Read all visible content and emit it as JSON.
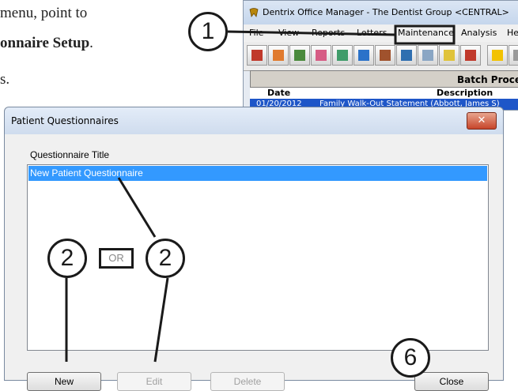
{
  "instructions": {
    "line1": "menu, point to",
    "line2": "onnaire Setup",
    "line2_period": ".",
    "line3": "s."
  },
  "office_manager": {
    "title": "Dentrix Office Manager - The Dentist Group <CENTRAL>",
    "menu": [
      "File",
      "View",
      "Reports",
      "Letters",
      "Maintenance",
      "Analysis",
      "He"
    ],
    "toolbar_icons": [
      "chart-icon",
      "patient-icon",
      "document-icon",
      "tooth-icon",
      "pencil-icon",
      "pen-icon",
      "book-icon",
      "man-icon",
      "window-icon",
      "note-icon",
      "chart2-icon",
      "lightning-icon",
      "info-icon"
    ],
    "batch_header": "Batch Proce",
    "columns": [
      "Date",
      "Description"
    ],
    "row": {
      "date": "01/20/2012",
      "description": "Family Walk-Out Statement (Abbott, James S)"
    }
  },
  "dialog": {
    "title": "Patient Questionnaires",
    "close_glyph": "✕",
    "column_label": "Questionnaire Title",
    "items": [
      "New Patient Questionnaire"
    ],
    "buttons": {
      "new": "New",
      "edit": "Edit",
      "delete": "Delete",
      "close": "Close"
    }
  },
  "callouts": {
    "one": "1",
    "two_a": "2",
    "or": "OR",
    "two_b": "2",
    "six": "6"
  },
  "colors": {
    "selection": "#3399ff",
    "batch_row": "#1e56c8",
    "close_button": "#c7452b"
  }
}
